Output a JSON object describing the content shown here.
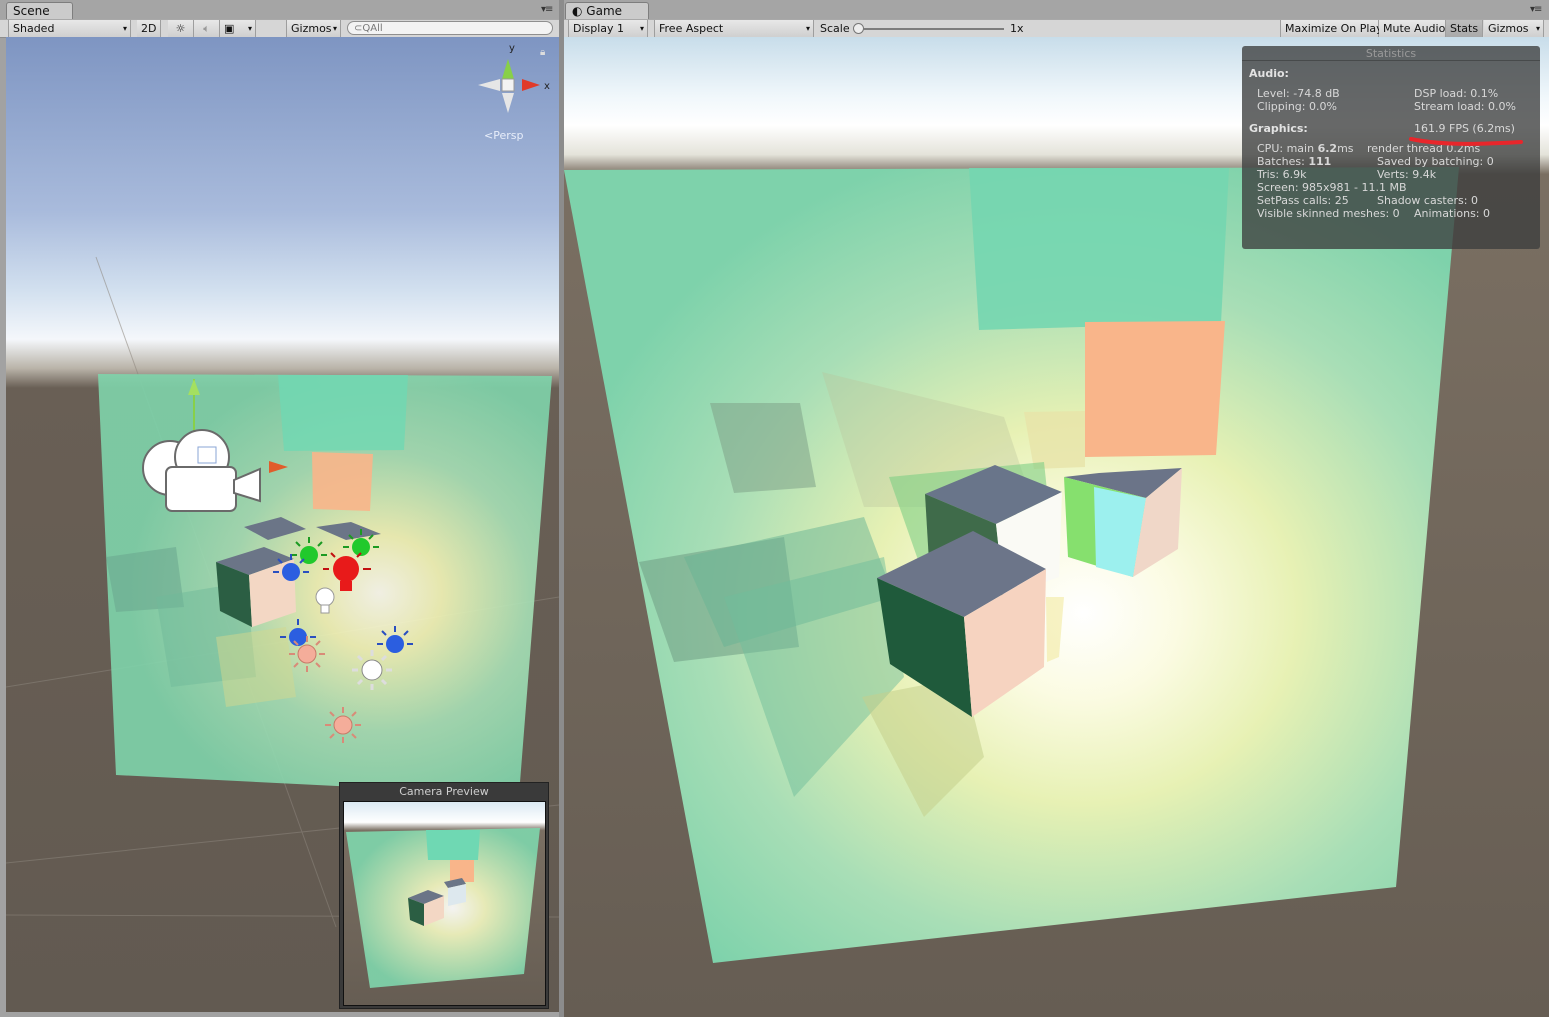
{
  "scene_tab": {
    "label": "Scene"
  },
  "scene_toolbar": {
    "draw_mode": "Shaded",
    "mode_2d": "2D",
    "gizmos": "Gizmos",
    "search_placeholder": "All",
    "light_icon": "sun-icon",
    "audio_icon": "speaker-icon",
    "effects_icon": "image-icon"
  },
  "scene_view": {
    "projection": "Persp",
    "axis_y": "y",
    "axis_x": "x"
  },
  "camera_preview": {
    "title": "Camera Preview"
  },
  "game_tab": {
    "label": "Game"
  },
  "game_toolbar": {
    "display": "Display 1",
    "aspect": "Free Aspect",
    "scale_label": "Scale",
    "scale_value": "1x",
    "maximize": "Maximize On Play",
    "mute": "Mute Audio",
    "stats": "Stats",
    "gizmos": "Gizmos"
  },
  "statistics": {
    "title": "Statistics",
    "audio_heading": "Audio:",
    "level": "Level: -74.8 dB",
    "clipping": "Clipping: 0.0%",
    "dsp_load": "DSP load: 0.1%",
    "stream_load": "Stream load: 0.0%",
    "graphics_heading": "Graphics:",
    "fps": "161.9 FPS (6.2ms)",
    "cpu_main_label": "CPU: main ",
    "cpu_main_value": "6.2",
    "cpu_main_unit": "ms",
    "render_thread": "render thread 0.2ms",
    "batches_label": "Batches: ",
    "batches_value": "111",
    "saved_by_batching": "Saved by batching: 0",
    "tris": "Tris: 6.9k",
    "verts": "Verts: 9.4k",
    "screen": "Screen: 985x981 - 11.1 MB",
    "setpass": "SetPass calls: 25",
    "shadow_casters": "Shadow casters: 0",
    "skinned": "Visible skinned meshes: 0",
    "animations": "Animations: 0"
  },
  "colors": {
    "annotation_red": "#e8262b",
    "stats_bg": "#3c3e3e",
    "floor": "#665d53"
  }
}
